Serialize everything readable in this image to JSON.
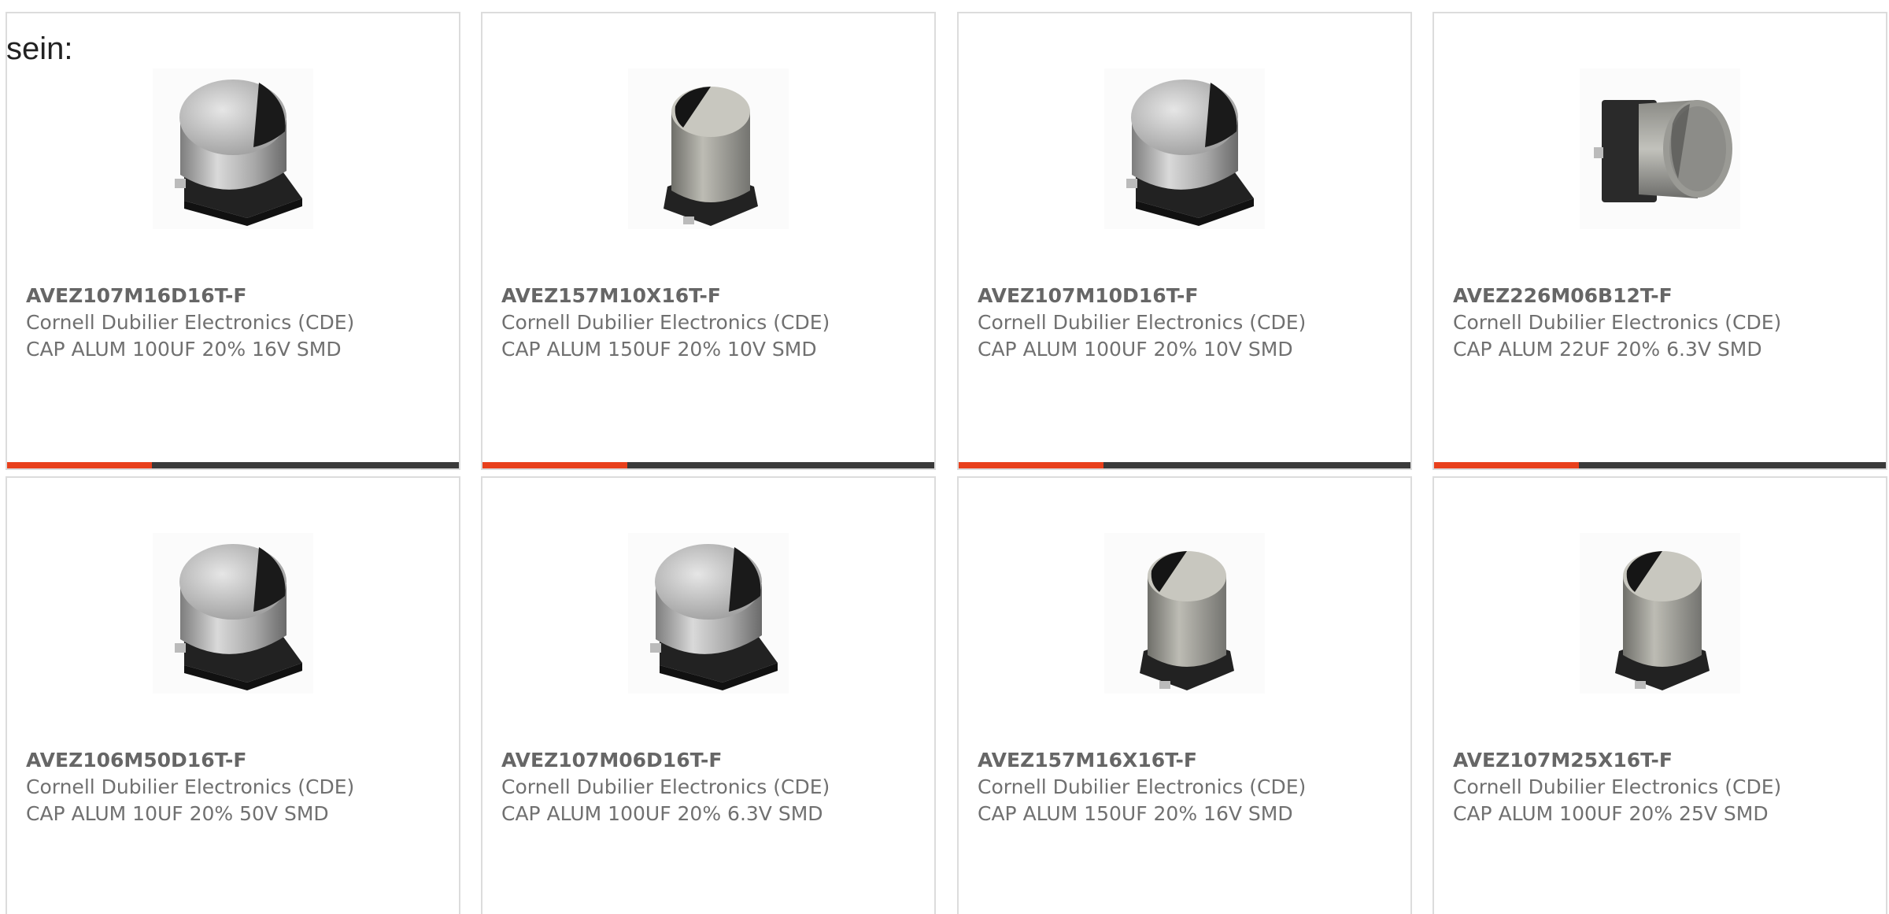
{
  "intro": {
    "text": "sein:"
  },
  "colors": {
    "accent": "#e8401c",
    "track": "#3a3a3a",
    "card_border": "#dcdcdc",
    "part_text": "#666666",
    "body_text": "#707070"
  },
  "products": [
    {
      "part_number": "AVEZ107M16D16T-F",
      "manufacturer": "Cornell Dubilier Electronics (CDE)",
      "description": "CAP ALUM 100UF 20% 16V SMD",
      "image_icon": "capacitor-wide-image",
      "progress": 0.32
    },
    {
      "part_number": "AVEZ157M10X16T-F",
      "manufacturer": "Cornell Dubilier Electronics (CDE)",
      "description": "CAP ALUM 150UF 20% 10V SMD",
      "image_icon": "capacitor-tall-image",
      "progress": 0.32
    },
    {
      "part_number": "AVEZ107M10D16T-F",
      "manufacturer": "Cornell Dubilier Electronics (CDE)",
      "description": "CAP ALUM 100UF 20% 10V SMD",
      "image_icon": "capacitor-wide-image",
      "progress": 0.32
    },
    {
      "part_number": "AVEZ226M06B12T-F",
      "manufacturer": "Cornell Dubilier Electronics (CDE)",
      "description": "CAP ALUM 22UF 20% 6.3V SMD",
      "image_icon": "capacitor-side-image",
      "progress": 0.32
    },
    {
      "part_number": "AVEZ106M50D16T-F",
      "manufacturer": "Cornell Dubilier Electronics (CDE)",
      "description": "CAP ALUM 10UF 20% 50V SMD",
      "image_icon": "capacitor-wide-image",
      "progress": null
    },
    {
      "part_number": "AVEZ107M06D16T-F",
      "manufacturer": "Cornell Dubilier Electronics (CDE)",
      "description": "CAP ALUM 100UF 20% 6.3V SMD",
      "image_icon": "capacitor-wide-image",
      "progress": null
    },
    {
      "part_number": "AVEZ157M16X16T-F",
      "manufacturer": "Cornell Dubilier Electronics (CDE)",
      "description": "CAP ALUM 150UF 20% 16V SMD",
      "image_icon": "capacitor-tall-image",
      "progress": null
    },
    {
      "part_number": "AVEZ107M25X16T-F",
      "manufacturer": "Cornell Dubilier Electronics (CDE)",
      "description": "CAP ALUM 100UF 20% 25V SMD",
      "image_icon": "capacitor-tall-image",
      "progress": null
    }
  ]
}
